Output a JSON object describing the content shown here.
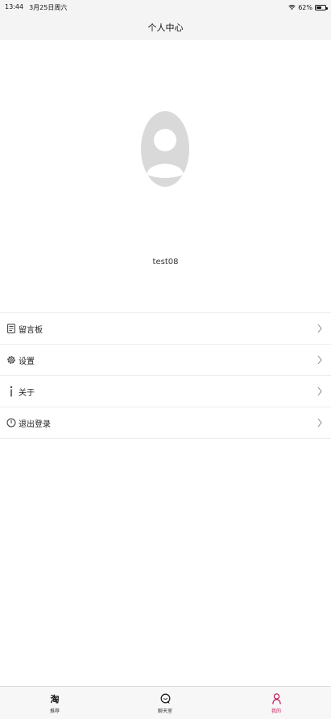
{
  "status_bar": {
    "time": "13:44",
    "date": "3月25日周六",
    "battery": "62%",
    "battery_level": 0.62
  },
  "nav": {
    "title": "个人中心"
  },
  "profile": {
    "username": "test08",
    "avatar_icon": "user-avatar-icon"
  },
  "menu": {
    "items": [
      {
        "label": "留言板",
        "icon": "message-board-icon"
      },
      {
        "label": "设置",
        "icon": "gear-icon"
      },
      {
        "label": "关于",
        "icon": "info-icon"
      },
      {
        "label": "退出登录",
        "icon": "power-icon"
      }
    ]
  },
  "tab_bar": {
    "tabs": [
      {
        "label": "推荐",
        "icon": "taobao-icon",
        "glyph": "淘",
        "active": false
      },
      {
        "label": "聊天室",
        "icon": "chat-icon",
        "active": false
      },
      {
        "label": "我的",
        "icon": "person-icon",
        "active": true
      }
    ]
  },
  "colors": {
    "active_tab": "#c2185b",
    "bar_background": "#f4f4f4",
    "avatar_gray": "#d9d9d9"
  }
}
